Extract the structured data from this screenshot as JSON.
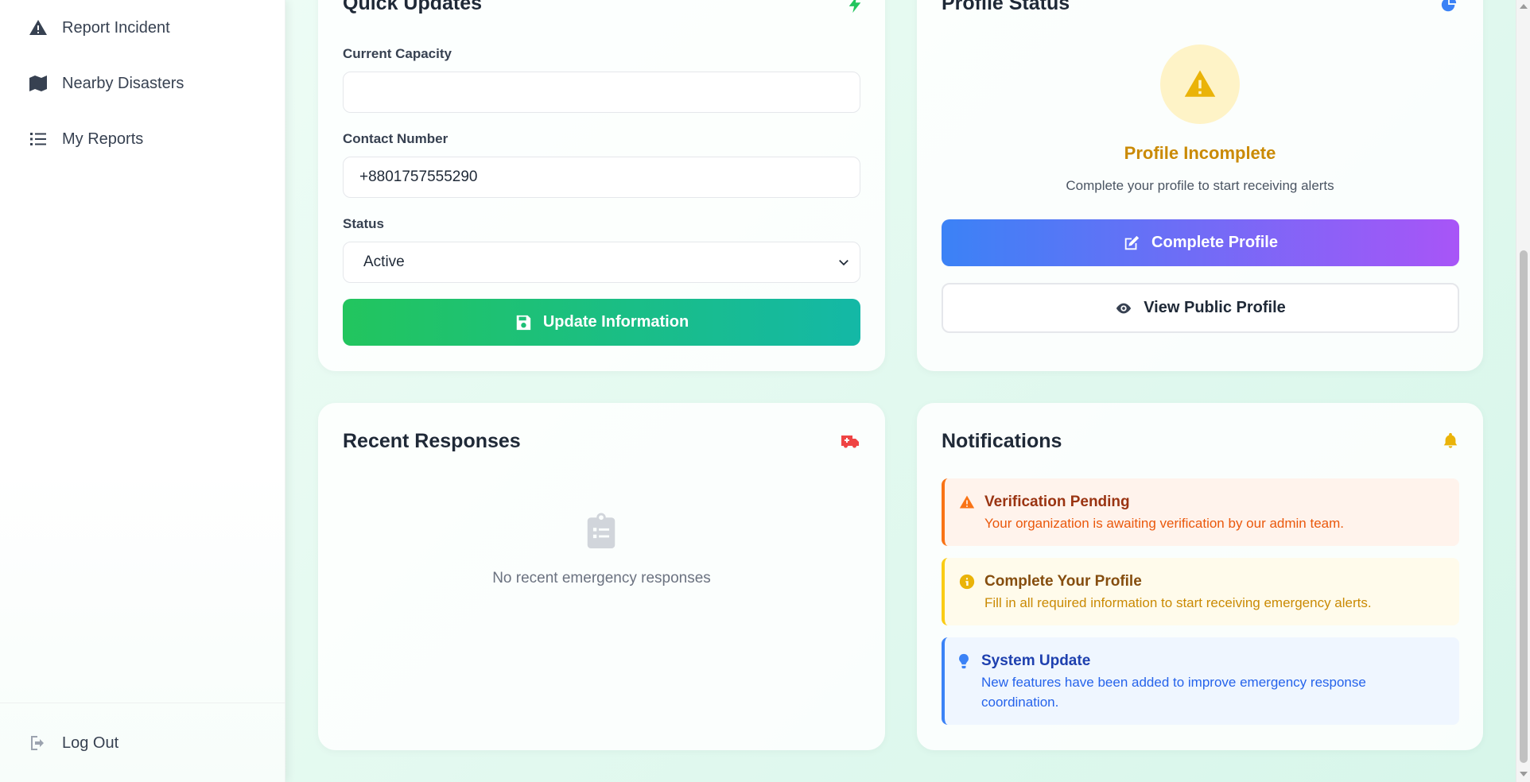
{
  "sidebar": {
    "items": [
      {
        "label": "Report Incident",
        "icon": "warning-triangle-icon"
      },
      {
        "label": "Nearby Disasters",
        "icon": "map-icon"
      },
      {
        "label": "My Reports",
        "icon": "list-icon"
      }
    ],
    "logout": {
      "label": "Log Out",
      "icon": "logout-icon"
    }
  },
  "quick_updates": {
    "title": "Quick Updates",
    "icon": "bolt-icon",
    "capacity_label": "Current Capacity",
    "capacity_value": "",
    "contact_label": "Contact Number",
    "contact_value": "+8801757555290",
    "status_label": "Status",
    "status_value": "Active",
    "button": "Update Information"
  },
  "profile_status": {
    "title": "Profile Status",
    "icon": "pie-chart-icon",
    "state": "Profile Incomplete",
    "description": "Complete your profile to start receiving alerts",
    "complete_button": "Complete Profile",
    "view_button": "View Public Profile"
  },
  "recent_responses": {
    "title": "Recent Responses",
    "icon": "ambulance-icon",
    "empty": "No recent emergency responses"
  },
  "notifications": {
    "title": "Notifications",
    "icon": "bell-icon",
    "items": [
      {
        "title": "Verification Pending",
        "text": "Your organization is awaiting verification by our admin team.",
        "icon": "warning-triangle-icon"
      },
      {
        "title": "Complete Your Profile",
        "text": "Fill in all required information to start receiving emergency alerts.",
        "icon": "info-circle-icon"
      },
      {
        "title": "System Update",
        "text": "New features have been added to improve emergency response coordination.",
        "icon": "lightbulb-icon"
      }
    ]
  },
  "colors": {
    "green_start": "#22c55e",
    "green_end": "#14b8a6",
    "blue_start": "#3b82f6",
    "purple_end": "#a855f7",
    "warning": "#eab308",
    "orange": "#f97316",
    "red": "#ef4444"
  }
}
